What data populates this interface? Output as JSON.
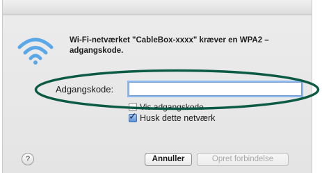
{
  "dialog": {
    "message": "Wi-Fi-netværket \"CableBox-xxxx\" kræver en WPA2 –adgangskode.",
    "password_label": "Adgangskode:",
    "password_value": "",
    "show_password_label": "Vis adgangskode",
    "show_password_checked": false,
    "remember_label": "Husk dette netværk",
    "remember_checked": true,
    "help_glyph": "?",
    "cancel_label": "Annuller",
    "connect_label": "Opret forbindelse",
    "connect_enabled": false
  },
  "icons": {
    "wifi": "wifi-icon",
    "help": "help-icon",
    "checkmark": "checkmark-icon"
  },
  "colors": {
    "annotation_ellipse": "#0b5a43",
    "wifi_blue": "#5aa8e8",
    "focus_ring": "#8db8ec"
  }
}
